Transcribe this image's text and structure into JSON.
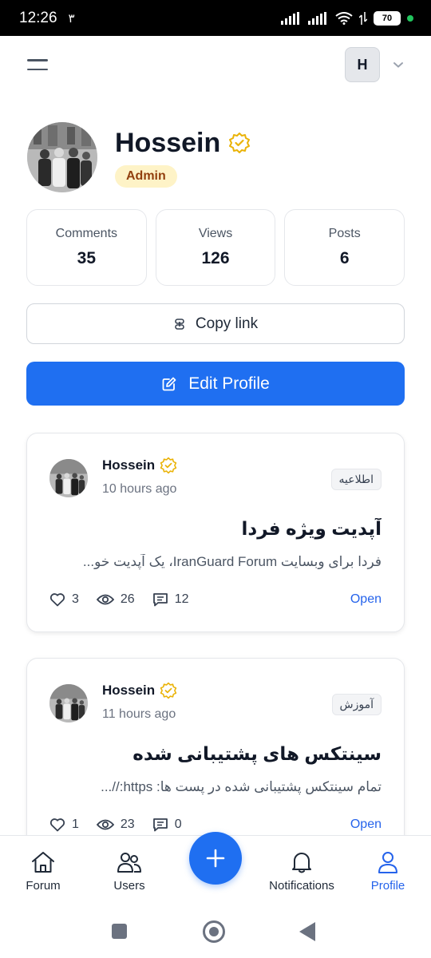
{
  "status_bar": {
    "time": "12:26",
    "notification_count": "۳",
    "battery": "70"
  },
  "header": {
    "avatar_initial": "H"
  },
  "profile": {
    "name": "Hossein",
    "role_badge": "Admin",
    "verified": true
  },
  "stats": [
    {
      "label": "Comments",
      "value": "35"
    },
    {
      "label": "Views",
      "value": "126"
    },
    {
      "label": "Posts",
      "value": "6"
    }
  ],
  "actions": {
    "copy_link": "Copy link",
    "edit_profile": "Edit Profile"
  },
  "posts": [
    {
      "author": "Hossein",
      "time": "10 hours ago",
      "tag": "اطلاعیه",
      "title": "آپدیت ویژه فردا",
      "excerpt": "فردا برای وبسایت IranGuard Forum، یک آپدیت خو...",
      "likes": "3",
      "views": "26",
      "comments": "12",
      "open_label": "Open"
    },
    {
      "author": "Hossein",
      "time": "11 hours ago",
      "tag": "آموزش",
      "title": "سینتکس های پشتیبانی شده",
      "excerpt": "تمام سینتکس پشتیبانی شده در پست ها: https://...",
      "likes": "1",
      "views": "23",
      "comments": "0",
      "open_label": "Open"
    }
  ],
  "bottom_nav": {
    "items": [
      {
        "label": "Forum",
        "icon": "home-icon"
      },
      {
        "label": "Users",
        "icon": "users-icon"
      },
      {
        "label": "Notifications",
        "icon": "bell-icon"
      },
      {
        "label": "Profile",
        "icon": "user-icon"
      }
    ],
    "active": "Profile"
  },
  "colors": {
    "primary": "#1f6ff1",
    "link": "#2563eb",
    "admin_badge_bg": "#fef3c7",
    "admin_badge_text": "#92400e",
    "verified_gold": "#eab308"
  }
}
